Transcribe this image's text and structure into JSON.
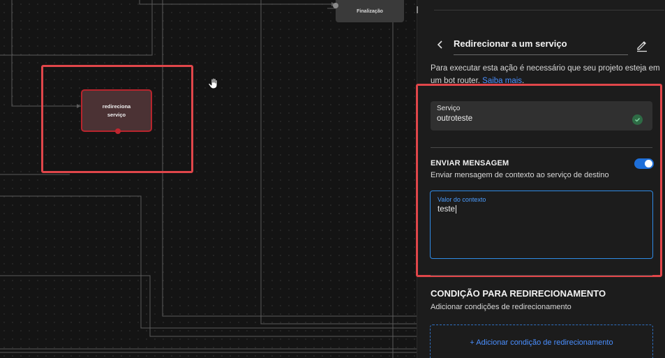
{
  "canvas": {
    "nodes": {
      "finalizacao": "Finalização",
      "redireciona_line1": "redireciona",
      "redireciona_line2": "serviço"
    }
  },
  "panel": {
    "title": "Redirecionar a um serviço",
    "info_text": "Para executar esta ação é necessário que seu projeto esteja em um bot router. ",
    "info_link": "Saiba mais",
    "info_end": ".",
    "service": {
      "label": "Serviço",
      "value": "outroteste",
      "status_icon": "check-circle-icon"
    },
    "send_message": {
      "title": "ENVIAR MENSAGEM",
      "description": "Enviar mensagem de contexto ao serviço de destino",
      "enabled": true
    },
    "context": {
      "label": "Valor do contexto",
      "value": "teste"
    },
    "condition": {
      "title": "CONDIÇÃO PARA REDIRECIONAMENTO",
      "description": "Adicionar condições de redirecionamento",
      "add_button": "+ Adicionar condição de redirecionamento"
    }
  },
  "colors": {
    "accent_blue": "#1e6fd9",
    "link_blue": "#4a8fff",
    "highlight_red": "#e0464a",
    "node_red": "#b8252d"
  }
}
